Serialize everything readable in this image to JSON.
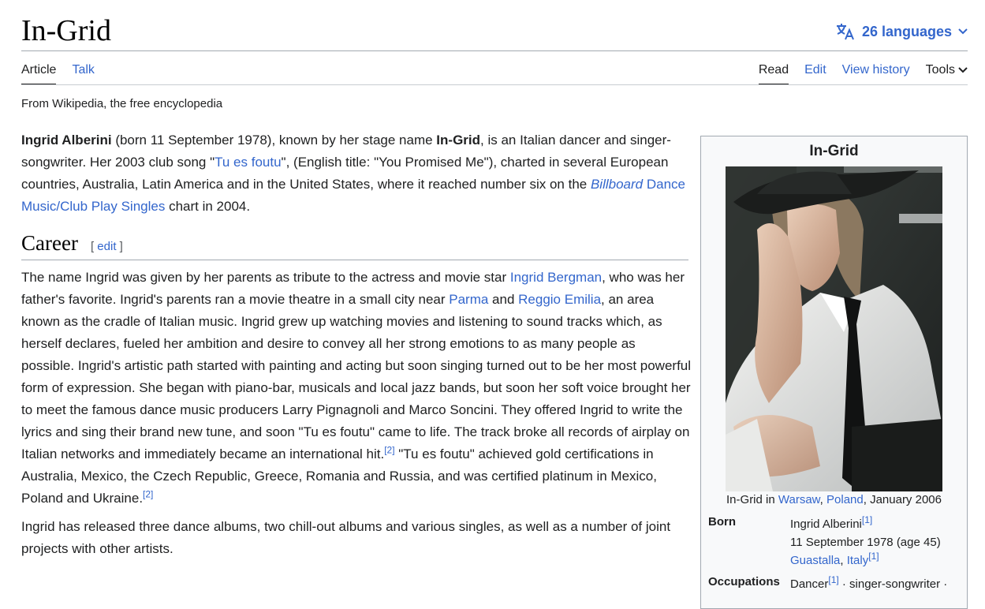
{
  "header": {
    "title": "In-Grid",
    "languages_label": "26 languages"
  },
  "tabs": {
    "article": "Article",
    "talk": "Talk",
    "read": "Read",
    "edit": "Edit",
    "history": "View history",
    "tools": "Tools"
  },
  "tagline": "From Wikipedia, the free encyclopedia",
  "intro": {
    "name_bold": "Ingrid Alberini",
    "t1": " (born 11 September 1978), known by her stage name ",
    "stage_bold": "In-Grid",
    "t2": ", is an Italian dancer and singer-songwriter. Her 2003 club song \"",
    "song_link": "Tu es foutu",
    "t3": "\", (English title: \"You Promised Me\"), charted in several European countries, Australia, Latin America and in the United States, where it reached number six on the ",
    "billboard_link": "Billboard",
    "chart_link": " Dance Music/Club Play Singles",
    "t4": " chart in 2004."
  },
  "career": {
    "heading": "Career",
    "edit_open": "[ ",
    "edit_label": "edit",
    "edit_close": " ]",
    "p1_a": "The name Ingrid was given by her parents as tribute to the actress and movie star ",
    "link_bergman": "Ingrid Bergman",
    "p1_b": ", who was her father's favorite. Ingrid's parents ran a movie theatre in a small city near ",
    "link_parma": "Parma",
    "p1_c": " and ",
    "link_reggio": "Reggio Emilia",
    "p1_d": ", an area known as the cradle of Italian music. Ingrid grew up watching movies and listening to sound tracks which, as herself declares, fueled her ambition and desire to convey all her strong emotions to as many people as possible. Ingrid's artistic path started with painting and acting but soon singing turned out to be her most powerful form of expression. She began with piano-bar, musicals and local jazz bands, but soon her soft voice brought her to meet the famous dance music producers Larry Pignagnoli and Marco Soncini. They offered Ingrid to write the lyrics and sing their brand new tune, and soon \"Tu es foutu\" came to life. The track broke all records of airplay on Italian networks and immediately became an international hit.",
    "ref2a": "[2]",
    "p1_e": " \"Tu es foutu\" achieved gold certifications in Australia, Mexico, the Czech Republic, Greece, Romania and Russia, and was certified platinum in Mexico, Poland and Ukraine.",
    "ref2b": "[2]",
    "p2": "Ingrid has released three dance albums, two chill-out albums and various singles, as well as a number of joint projects with other artists."
  },
  "infobox": {
    "title": "In-Grid",
    "caption_a": "In-Grid in ",
    "caption_warsaw": "Warsaw",
    "caption_sep": ", ",
    "caption_poland": "Poland",
    "caption_b": ", January 2006",
    "born_label": "Born",
    "born_name": "Ingrid Alberini",
    "ref1": "[1]",
    "born_date": "11 September 1978 (age 45)",
    "born_place_a": "Guastalla",
    "born_place_sep": ", ",
    "born_place_b": "Italy",
    "occ_label": "Occupations",
    "occ_a": "Dancer",
    "occ_b": " · singer-songwriter ·"
  }
}
